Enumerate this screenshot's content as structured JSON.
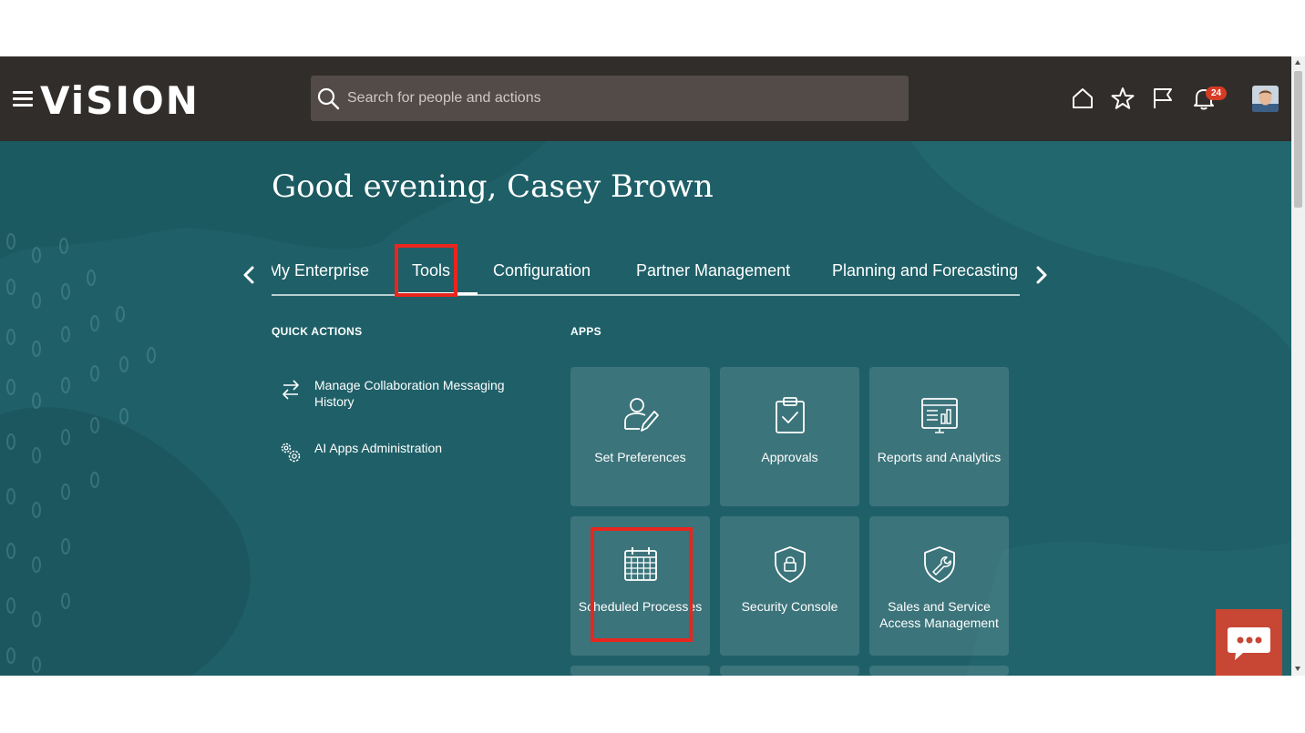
{
  "header": {
    "logo": "ViSION",
    "search_placeholder": "Search for people and actions",
    "notification_count": "24",
    "icons": [
      "menu-icon",
      "search-icon",
      "home-icon",
      "star-icon",
      "flag-icon",
      "bell-icon",
      "avatar"
    ]
  },
  "greeting": "Good evening, Casey Brown",
  "tabs": [
    {
      "label": "My Enterprise",
      "active": false
    },
    {
      "label": "Tools",
      "active": true
    },
    {
      "label": "Configuration",
      "active": false
    },
    {
      "label": "Partner Management",
      "active": false
    },
    {
      "label": "Planning and Forecasting",
      "active": false
    }
  ],
  "quick_actions": {
    "title": "QUICK ACTIONS",
    "items": [
      {
        "label": "Manage Collaboration Messaging History",
        "icon": "swap-arrows-icon"
      },
      {
        "label": "AI Apps Administration",
        "icon": "gears-icon"
      }
    ]
  },
  "apps": {
    "title": "APPS",
    "tiles": [
      {
        "label": "Set Preferences",
        "icon": "user-pen-icon"
      },
      {
        "label": "Approvals",
        "icon": "clipboard-check-icon"
      },
      {
        "label": "Reports and Analytics",
        "icon": "report-chart-icon"
      },
      {
        "label": "Scheduled Processes",
        "icon": "calendar-grid-icon"
      },
      {
        "label": "Security Console",
        "icon": "shield-lock-icon"
      },
      {
        "label": "Sales and Service Access Management",
        "icon": "shield-wrench-icon"
      }
    ]
  },
  "colors": {
    "topbar": "#312d2a",
    "hero": "#1f6068",
    "highlight": "#e8261e",
    "chat": "#c74634",
    "badge": "#d63b25"
  }
}
